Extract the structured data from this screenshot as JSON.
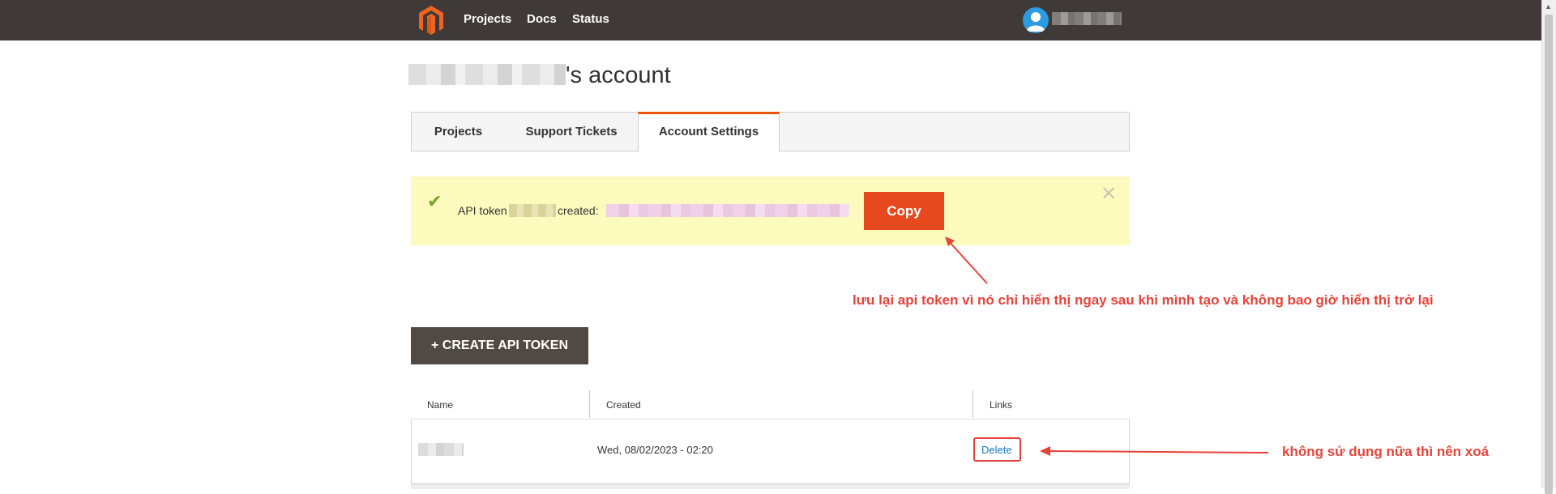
{
  "nav": {
    "links": [
      "Projects",
      "Docs",
      "Status"
    ]
  },
  "page": {
    "title": "'s account"
  },
  "tabs": [
    {
      "label": "Projects"
    },
    {
      "label": "Support Tickets"
    },
    {
      "label": "Account Settings",
      "active": true
    }
  ],
  "message": {
    "prefix": "API token",
    "middle": "created:",
    "copy_label": "Copy",
    "close_glyph": "✕"
  },
  "annotations": {
    "copy_note": "lưu lại api token vì nó chỉ hiển thị ngay sau khi mình tạo và không bao giờ hiển thị trở lại",
    "delete_note": "không sử dụng nữa thì nên xoá"
  },
  "create_button": {
    "label": "+ CREATE API TOKEN"
  },
  "table": {
    "headers": [
      "Name",
      "Created",
      "Links"
    ],
    "rows": [
      {
        "created": "Wed, 08/02/2023 - 02:20",
        "link": "Delete"
      }
    ]
  },
  "colors": {
    "accent": "#eb5202",
    "copy_button": "#e6491d",
    "message_bg": "#fdfabd",
    "annotation": "#e8433a",
    "topbar": "#3f3a37"
  },
  "icons": {
    "logo": "magento-logo",
    "avatar": "user-avatar-icon",
    "message": "check-icon",
    "close": "close-icon"
  }
}
